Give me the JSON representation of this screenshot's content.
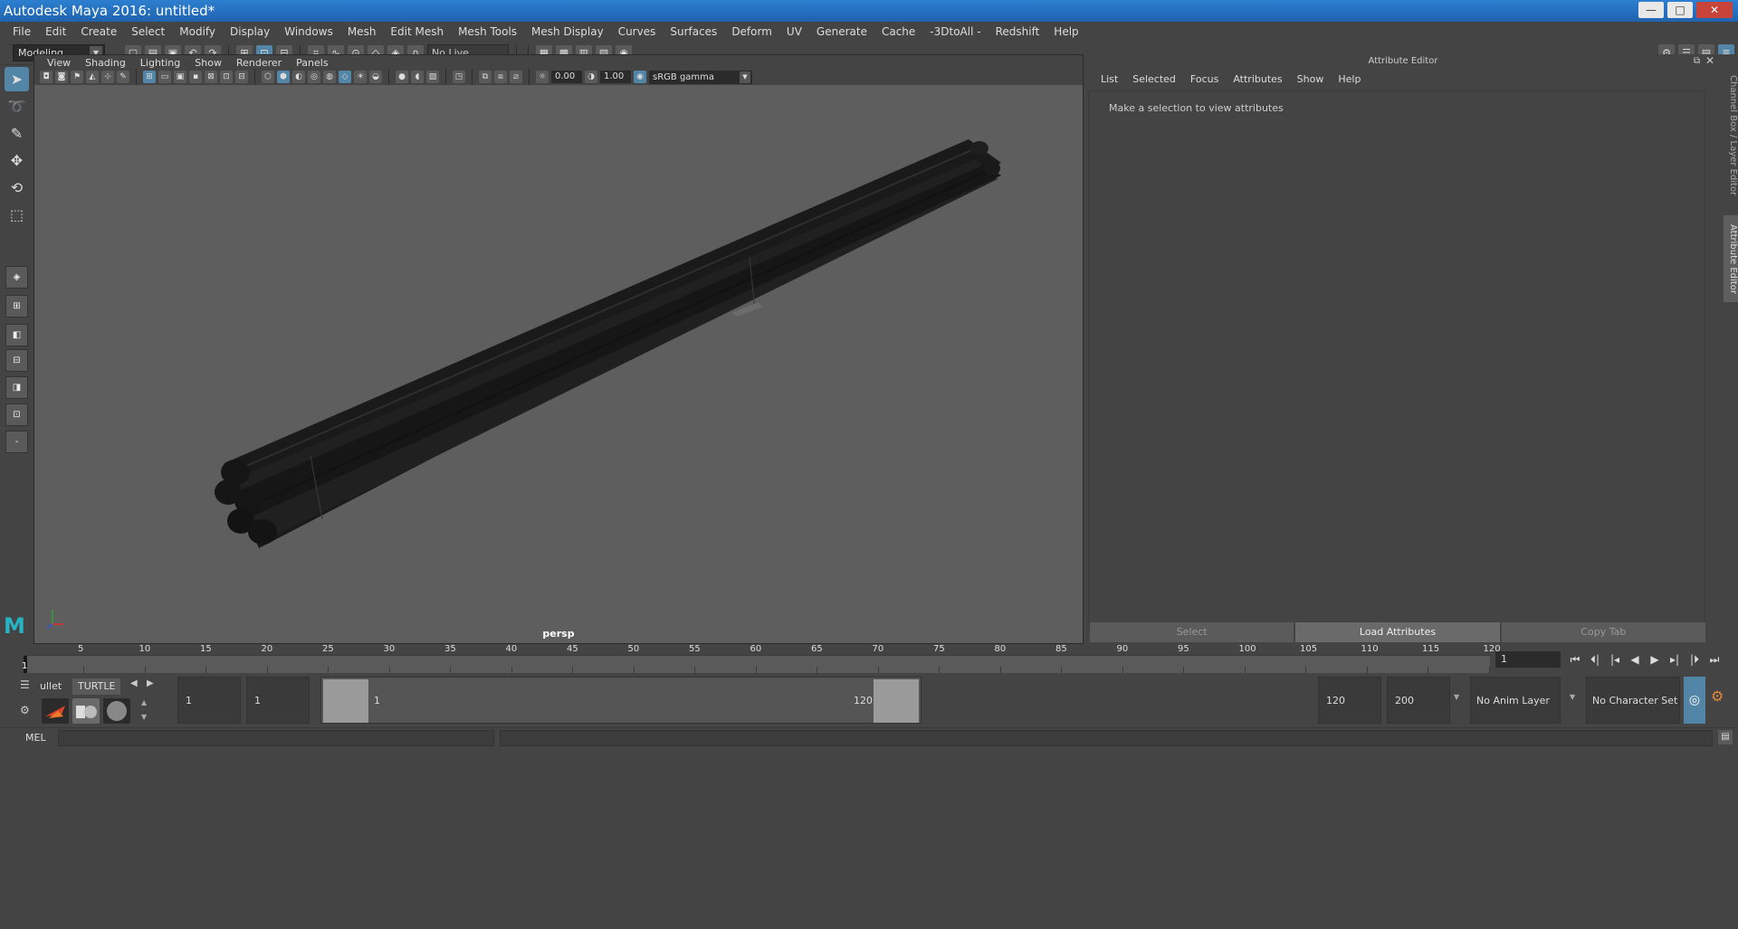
{
  "window": {
    "title": "Autodesk Maya 2016: untitled*",
    "buttons": [
      "—",
      "□",
      "✕"
    ]
  },
  "menubar": [
    "File",
    "Edit",
    "Create",
    "Select",
    "Modify",
    "Display",
    "Windows",
    "Mesh",
    "Edit Mesh",
    "Mesh Tools",
    "Mesh Display",
    "Curves",
    "Surfaces",
    "Deform",
    "UV",
    "Generate",
    "Cache",
    "-3DtoAll -",
    "Redshift",
    "Help"
  ],
  "statusline": {
    "mode": "Modeling",
    "live_surface": "No Live Surface"
  },
  "viewport": {
    "menu": [
      "View",
      "Shading",
      "Lighting",
      "Show",
      "Renderer",
      "Panels"
    ],
    "exposure": "0.00",
    "gamma": "1.00",
    "color_space": "sRGB gamma",
    "camera_label": "persp"
  },
  "attribute_editor": {
    "header": "Attribute Editor",
    "menu": [
      "List",
      "Selected",
      "Focus",
      "Attributes",
      "Show",
      "Help"
    ],
    "message": "Make a selection to view attributes",
    "buttons": [
      "Select",
      "Load Attributes",
      "Copy Tab"
    ]
  },
  "side_tabs": [
    "Channel Box / Layer Editor",
    "Attribute Editor"
  ],
  "timeslider": {
    "current_frame": "1",
    "marker_label": "1",
    "ticks": [
      "5",
      "10",
      "15",
      "20",
      "25",
      "30",
      "35",
      "40",
      "45",
      "50",
      "55",
      "60",
      "65",
      "70",
      "75",
      "80",
      "85",
      "90",
      "95",
      "100",
      "105",
      "110",
      "115",
      "120"
    ]
  },
  "shelf": {
    "tabs": [
      "ullet",
      "TURTLE"
    ]
  },
  "range": {
    "start": "1",
    "playback_start": "1",
    "slider_start": "1",
    "slider_end": "120",
    "playback_end": "120",
    "end": "200",
    "anim_layer": "No Anim Layer",
    "character_set": "No Character Set"
  },
  "cmdline": {
    "label": "MEL"
  }
}
